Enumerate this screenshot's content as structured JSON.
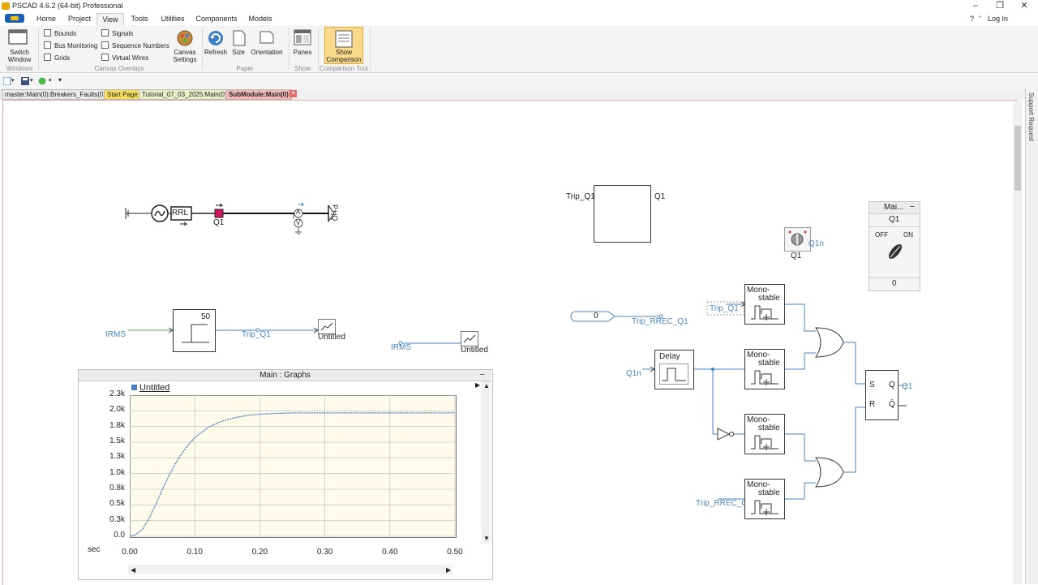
{
  "window": {
    "title": "PSCAD 4.6.2 (64-bit) Professional",
    "login_label": "Log In",
    "minimize": "–",
    "maximize": "❐",
    "close": "✕",
    "help": "?",
    "collapse": "⌃"
  },
  "menu": {
    "tabs": [
      "Home",
      "Project",
      "View",
      "Tools",
      "Utilities",
      "Components",
      "Models"
    ],
    "active": "View"
  },
  "ribbon": {
    "switch_window": "Switch Window",
    "windows_group": "Windows",
    "overlays": {
      "bounds": "Bounds",
      "bus_monitoring": "Bus Monitoring",
      "grids": "Grids",
      "signals": "Signals",
      "sequence_numbers": "Sequence Numbers",
      "virtual_wires": "Virtual Wires"
    },
    "canvas_overlays_group": "Canvas Overlays",
    "canvas_settings": "Canvas Settings",
    "refresh": "Refresh",
    "size": "Size",
    "orientation": "Orientation",
    "paper_group": "Paper",
    "panes": "Panes",
    "show_group": "Show",
    "show_comparison": "Show Comparison",
    "comparison_group": "Comparison Tool"
  },
  "doc_tabs": [
    {
      "label": "master:Main(0):Breakers_Faults(0)",
      "color": "#e9e9e9"
    },
    {
      "label": "Start Page",
      "color": "#f3e15b"
    },
    {
      "label": "Tutorial_07_03_2025:Main(0)",
      "color": "#e9f0c8"
    },
    {
      "label": "SubModule:Main(0)",
      "color": "#f3b8b8"
    }
  ],
  "side_panel": "Support Request",
  "circuit": {
    "source_rrl": "RRL",
    "breaker_label": "Q1",
    "ammeter": "A",
    "voltmeter": "V",
    "pq_label": "P+jQ",
    "irms_1": "IRMS",
    "irms_2": "IRMS",
    "comparator_value": "50",
    "trip_q1_signal": "Trip_Q1",
    "untitled_1": "Untitled",
    "untitled_2": "Untitled",
    "trip_box_in": "Trip_Q1",
    "trip_box_out": "Q1",
    "breaker_icon_label": "Q1",
    "breaker_icon_signal": "Q1n",
    "const_value": "0",
    "trip_rrec_q1": "Trip_RREC_Q1",
    "trip_q1_in": "Trip_Q1",
    "q1n_in": "Q1n",
    "delay": "Delay",
    "monostable": "Mono-stable",
    "mono_line1": "Mono-",
    "mono_line2": "stable",
    "trip_rrec_q1_in": "Trip_RREC_Q1",
    "sr_s": "S",
    "sr_r": "R",
    "sr_q": "Q",
    "sr_qbar": "Q̄",
    "sr_out": "Q1"
  },
  "control_panel": {
    "title": "Mai...",
    "item": "Q1",
    "off": "OFF",
    "on": "ON",
    "value": "0",
    "collapse": "–"
  },
  "graph": {
    "frame_title": "Main : Graphs",
    "legend": "Untitled",
    "x_unit": "sec"
  },
  "chart_data": {
    "type": "line",
    "title": "Main : Graphs",
    "xlabel": "sec",
    "ylabel": "",
    "xlim": [
      0.0,
      0.5
    ],
    "ylim": [
      0.0,
      2.3
    ],
    "x_ticks": [
      "0.00",
      "0.10",
      "0.20",
      "0.30",
      "0.40",
      "0.50"
    ],
    "y_ticks": [
      "0.0",
      "0.3k",
      "0.5k",
      "0.8k",
      "1.0k",
      "1.3k",
      "1.5k",
      "1.8k",
      "2.0k",
      "2.3k"
    ],
    "grid": true,
    "legend_position": "top-left",
    "series": [
      {
        "name": "Untitled",
        "color": "#4a7fc0",
        "x": [
          0.0,
          0.01,
          0.02,
          0.03,
          0.04,
          0.05,
          0.06,
          0.07,
          0.08,
          0.09,
          0.1,
          0.12,
          0.14,
          0.16,
          0.18,
          0.2,
          0.22,
          0.25,
          0.3,
          0.35,
          0.4,
          0.45,
          0.5
        ],
        "y": [
          0.0,
          0.03,
          0.12,
          0.3,
          0.52,
          0.76,
          0.98,
          1.18,
          1.35,
          1.49,
          1.61,
          1.77,
          1.87,
          1.93,
          1.97,
          1.99,
          2.0,
          2.01,
          2.01,
          2.01,
          2.01,
          2.01,
          2.01
        ]
      }
    ]
  }
}
